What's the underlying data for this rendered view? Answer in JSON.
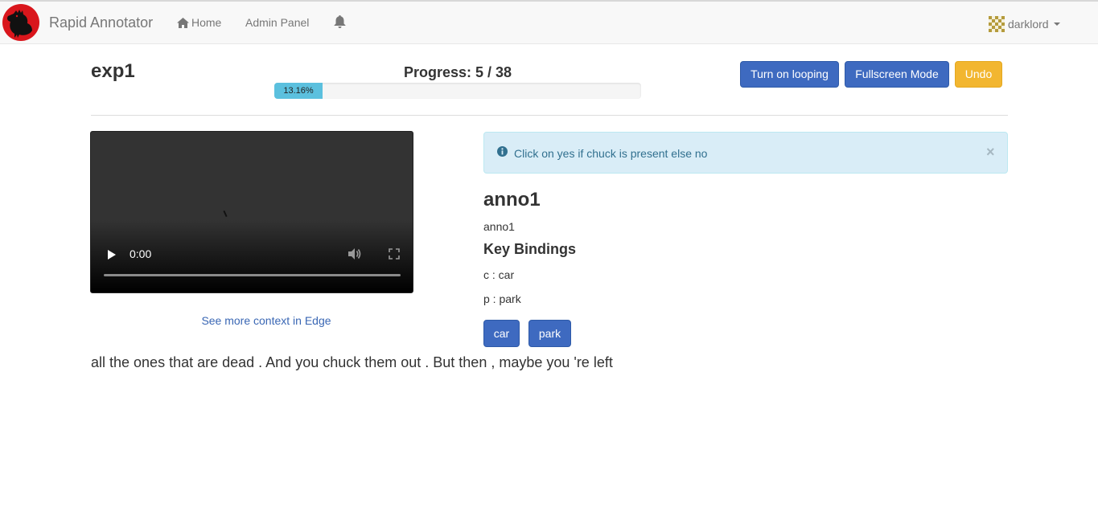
{
  "navbar": {
    "brand": "Rapid Annotator",
    "home": "Home",
    "admin": "Admin Panel",
    "user": "darklord"
  },
  "experiment": {
    "title": "exp1",
    "progress_label": "Progress: 5 / 38",
    "progress_percent_text": "13.16%",
    "progress_fraction": 0.1316
  },
  "toolbar": {
    "loop_label": "Turn on looping",
    "fullscreen_label": "Fullscreen Mode",
    "undo_label": "Undo"
  },
  "video": {
    "time": "0:00",
    "context_link": "See more context in Edge"
  },
  "alert": {
    "text": "Click on yes if chuck is present else no",
    "close": "×"
  },
  "annotation": {
    "title": "anno1",
    "description": "anno1",
    "key_bindings_title": "Key Bindings",
    "bindings": [
      "c : car",
      "p : park"
    ],
    "labels": [
      "car",
      "park"
    ]
  },
  "transcript": "all the ones that are dead . And you chuck them out . But then , maybe you 're left",
  "colors": {
    "primary": "#3e6ac0",
    "warning": "#f2b630",
    "progress": "#5bc0de",
    "alert_bg": "#d9edf7",
    "logo_red": "#d9161c"
  },
  "icons": {
    "logo": "rooster-logo-icon",
    "home": "home-icon",
    "bell": "bell-icon",
    "avatar": "identicon-avatar",
    "info": "info-circle-icon",
    "play": "play-icon",
    "volume": "volume-icon",
    "fullscreen": "fullscreen-icon"
  }
}
